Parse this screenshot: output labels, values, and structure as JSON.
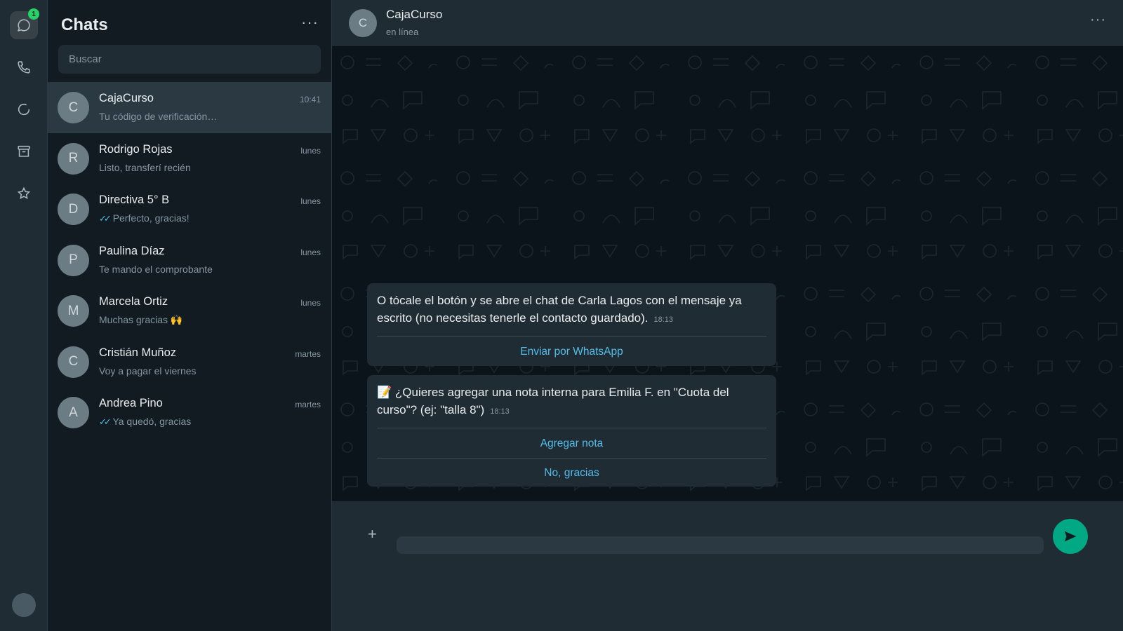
{
  "rail": {
    "chats_badge": "1",
    "icons": [
      "chat-icon",
      "phone-icon",
      "status-icon",
      "archive-icon",
      "star-icon"
    ]
  },
  "list": {
    "title": "Chats",
    "search_placeholder": "Buscar",
    "chats": [
      {
        "initial": "C",
        "name": "CajaCurso",
        "time": "10:41",
        "preview": "Tu código de verificación…",
        "ticks": "",
        "selected": true
      },
      {
        "initial": "R",
        "name": "Rodrigo Rojas",
        "time": "lunes",
        "preview": "Listo, transferí recién",
        "ticks": ""
      },
      {
        "initial": "D",
        "name": "Directiva 5° B",
        "time": "lunes",
        "preview": "Perfecto, gracias!",
        "ticks": "✓✓"
      },
      {
        "initial": "P",
        "name": "Paulina Díaz",
        "time": "lunes",
        "preview": "Te mando el comprobante",
        "ticks": ""
      },
      {
        "initial": "M",
        "name": "Marcela Ortiz",
        "time": "lunes",
        "preview": "Muchas gracias 🙌",
        "ticks": ""
      },
      {
        "initial": "C",
        "name": "Cristián Muñoz",
        "time": "martes",
        "preview": "Voy a pagar el viernes",
        "ticks": ""
      },
      {
        "initial": "A",
        "name": "Andrea Pino",
        "time": "martes",
        "preview": "Ya quedó, gracias",
        "ticks": "✓✓"
      }
    ]
  },
  "conversation": {
    "initial": "C",
    "title": "CajaCurso",
    "status": "en línea",
    "messages": [
      {
        "text": "O tócale el botón y se abre el chat de Carla Lagos con el mensaje ya escrito (no necesitas tenerle el contacto guardado).",
        "time": "18:13",
        "actions": [
          "Enviar por WhatsApp"
        ]
      },
      {
        "text": "📝 ¿Quieres agregar una nota interna para Emilia F. en \"Cuota del curso\"? (ej: \"talla 8\")",
        "time": "18:13",
        "actions": [
          "Agregar nota",
          "No, gracias"
        ]
      }
    ],
    "composer_value": ""
  },
  "colors": {
    "accent": "#00a884",
    "link": "#53bdeb",
    "panel": "#202c33",
    "background": "#111b21"
  }
}
